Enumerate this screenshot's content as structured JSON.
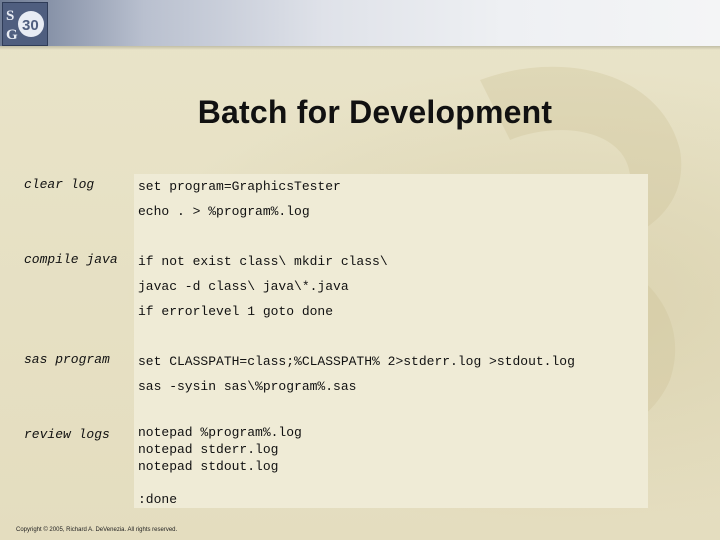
{
  "header": {
    "logo_icon": "sgf-30-logo"
  },
  "slide": {
    "title": "Batch for Development",
    "sections": [
      {
        "label": "clear log",
        "lines": [
          "set program=GraphicsTester",
          "echo . > %program%.log"
        ]
      },
      {
        "label": "compile java",
        "lines": [
          "if not exist class\\ mkdir class\\",
          "javac -d class\\ java\\*.java",
          "if errorlevel 1 goto done"
        ]
      },
      {
        "label": "sas program",
        "lines": [
          "set CLASSPATH=class;%CLASSPATH% 2>stderr.log >stdout.log",
          "sas -sysin sas\\%program%.sas"
        ]
      },
      {
        "label": "review logs",
        "lines": [
          "notepad %program%.log",
          "notepad stderr.log",
          "notepad stdout.log"
        ]
      }
    ],
    "done_label": ":done",
    "footer": "Copyright © 2005, Richard A. DeVenezia. All rights reserved."
  },
  "colors": {
    "background": "#e7e1c4",
    "code_panel": "#efebd6",
    "band_dark": "#6e7b94",
    "text": "#111111"
  }
}
